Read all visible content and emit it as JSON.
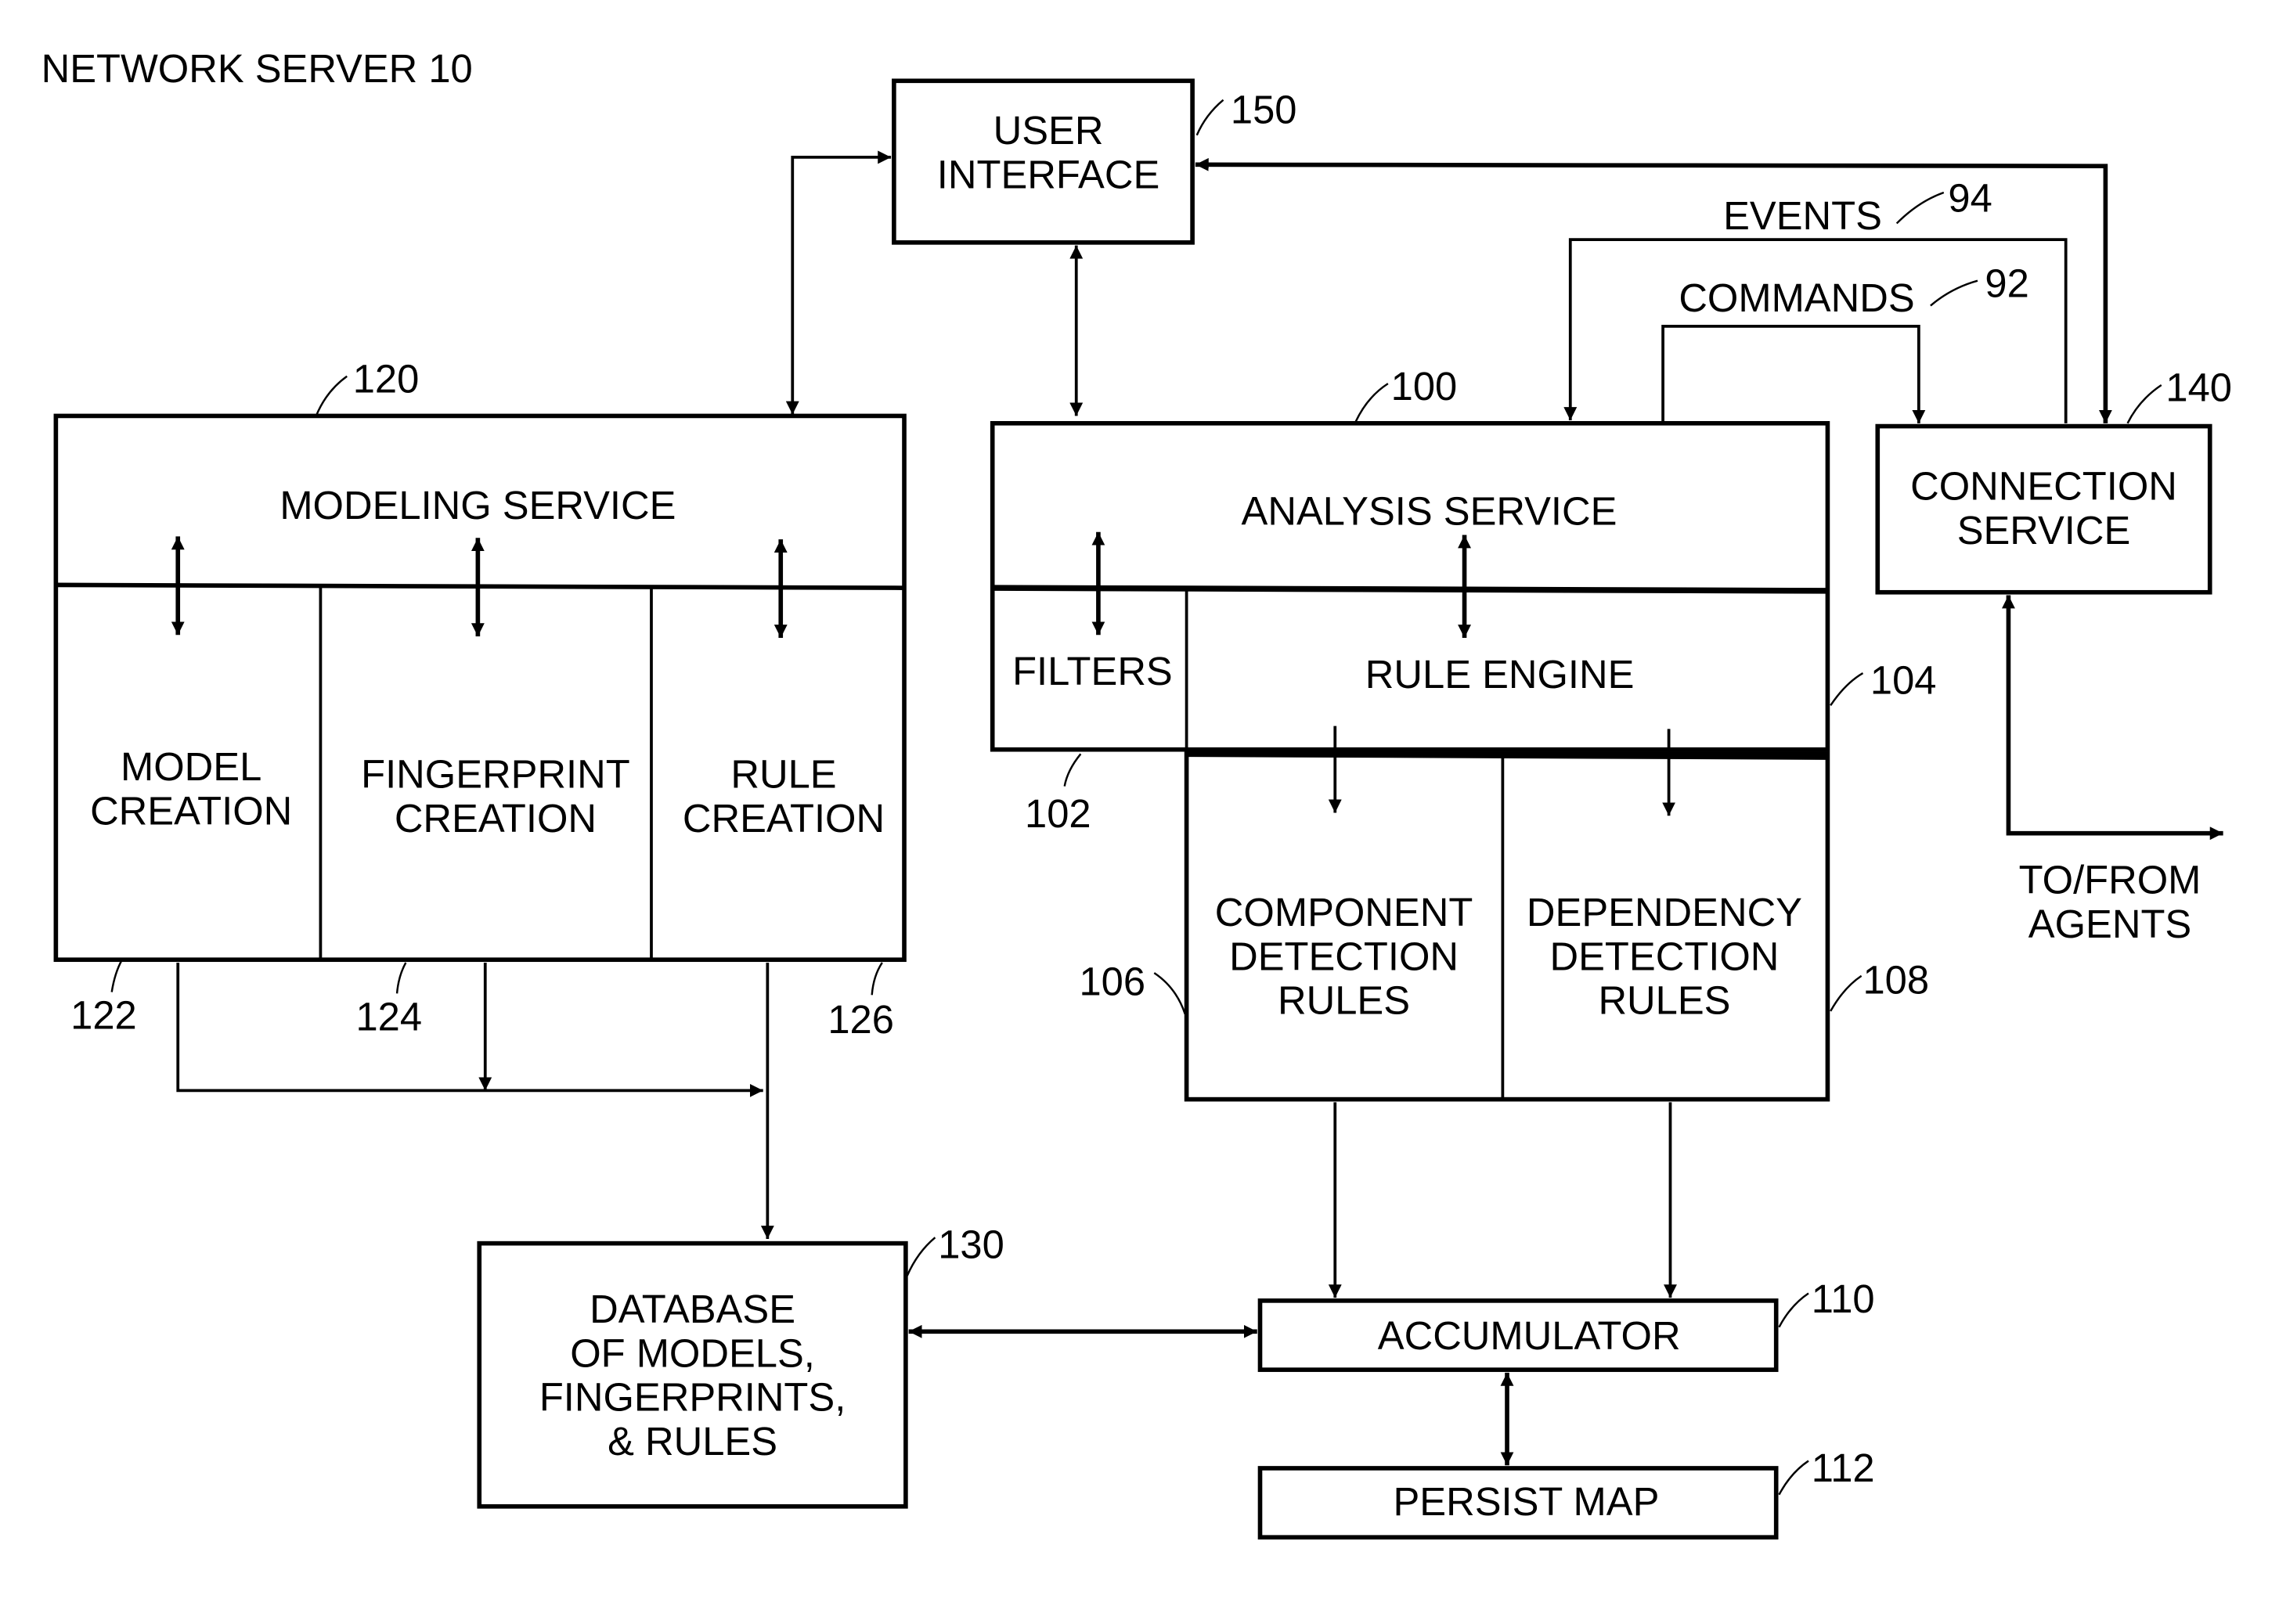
{
  "title": "NETWORK SERVER 10",
  "blocks": {
    "user_interface": {
      "lines": [
        "USER",
        "INTERFACE"
      ],
      "ref": "150"
    },
    "modeling_service": {
      "lines": [
        "MODELING SERVICE"
      ],
      "ref": "120"
    },
    "model_creation": {
      "lines": [
        "MODEL",
        "CREATION"
      ],
      "ref": "122"
    },
    "fingerprint_creation": {
      "lines": [
        "FINGERPRINT",
        "CREATION"
      ],
      "ref": "124"
    },
    "rule_creation": {
      "lines": [
        "RULE",
        "CREATION"
      ],
      "ref": "126"
    },
    "analysis_service": {
      "lines": [
        "ANALYSIS SERVICE"
      ],
      "ref": "100"
    },
    "filters": {
      "lines": [
        "FILTERS"
      ],
      "ref": "102"
    },
    "rule_engine": {
      "lines": [
        "RULE  ENGINE"
      ],
      "ref": "104"
    },
    "component_detection_rules": {
      "lines": [
        "COMPONENT",
        "DETECTION",
        "RULES"
      ],
      "ref": "106"
    },
    "dependency_detection_rules": {
      "lines": [
        "DEPENDENCY",
        "DETECTION",
        "RULES"
      ],
      "ref": "108"
    },
    "connection_service": {
      "lines": [
        "CONNECTION",
        "SERVICE"
      ],
      "ref": "140"
    },
    "database": {
      "lines": [
        "DATABASE",
        "OF MODELS,",
        "FINGERPRINTS,",
        "& RULES"
      ],
      "ref": "130"
    },
    "accumulator": {
      "lines": [
        "ACCUMULATOR"
      ],
      "ref": "110"
    },
    "persist_map": {
      "lines": [
        "PERSIST MAP"
      ],
      "ref": "112"
    }
  },
  "flows": {
    "events": {
      "label": "EVENTS",
      "ref": "94"
    },
    "commands": {
      "label": "COMMANDS",
      "ref": "92"
    },
    "agents": {
      "lines": [
        "TO/FROM",
        "AGENTS"
      ]
    }
  }
}
